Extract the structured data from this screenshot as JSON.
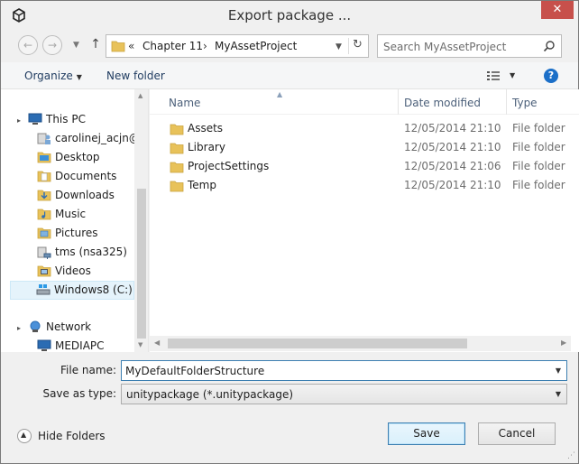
{
  "window": {
    "title": "Export package ...",
    "close_label": "✕"
  },
  "address": {
    "overflow": "«",
    "crumbs": [
      "Chapter 11",
      "MyAssetProject"
    ],
    "separator": "›"
  },
  "search": {
    "placeholder": "Search MyAssetProject"
  },
  "toolbar": {
    "organize_label": "Organize",
    "new_folder_label": "New folder",
    "help_label": "?"
  },
  "nav": {
    "this_pc": "This PC",
    "items": [
      {
        "label": "carolinej_acjn@h",
        "icon": "user-icon"
      },
      {
        "label": "Desktop",
        "icon": "folder-icon"
      },
      {
        "label": "Documents",
        "icon": "folder-icon"
      },
      {
        "label": "Downloads",
        "icon": "folder-icon"
      },
      {
        "label": "Music",
        "icon": "folder-icon"
      },
      {
        "label": "Pictures",
        "icon": "folder-icon"
      },
      {
        "label": "tms (nsa325)",
        "icon": "network-drive-icon"
      },
      {
        "label": "Videos",
        "icon": "folder-icon"
      },
      {
        "label": "Windows8 (C:)",
        "icon": "drive-icon"
      }
    ],
    "network": "Network",
    "network_items": [
      {
        "label": "MEDIAPC",
        "icon": "computer-icon"
      }
    ]
  },
  "files": {
    "columns": [
      "Name",
      "Date modified",
      "Type"
    ],
    "rows": [
      {
        "name": "Assets",
        "date": "12/05/2014 21:10",
        "type": "File folder"
      },
      {
        "name": "Library",
        "date": "12/05/2014 21:10",
        "type": "File folder"
      },
      {
        "name": "ProjectSettings",
        "date": "12/05/2014 21:06",
        "type": "File folder"
      },
      {
        "name": "Temp",
        "date": "12/05/2014 21:10",
        "type": "File folder"
      }
    ]
  },
  "form": {
    "filename_label": "File name:",
    "filename_value": "MyDefaultFolderStructure",
    "savetype_label": "Save as type:",
    "savetype_value": "unitypackage (*.unitypackage)"
  },
  "footer": {
    "hide_folders_label": "Hide Folders",
    "save_label": "Save",
    "cancel_label": "Cancel"
  },
  "colors": {
    "accent": "#3c7fb1",
    "close": "#c7504b",
    "folder": "#e8c25a"
  }
}
